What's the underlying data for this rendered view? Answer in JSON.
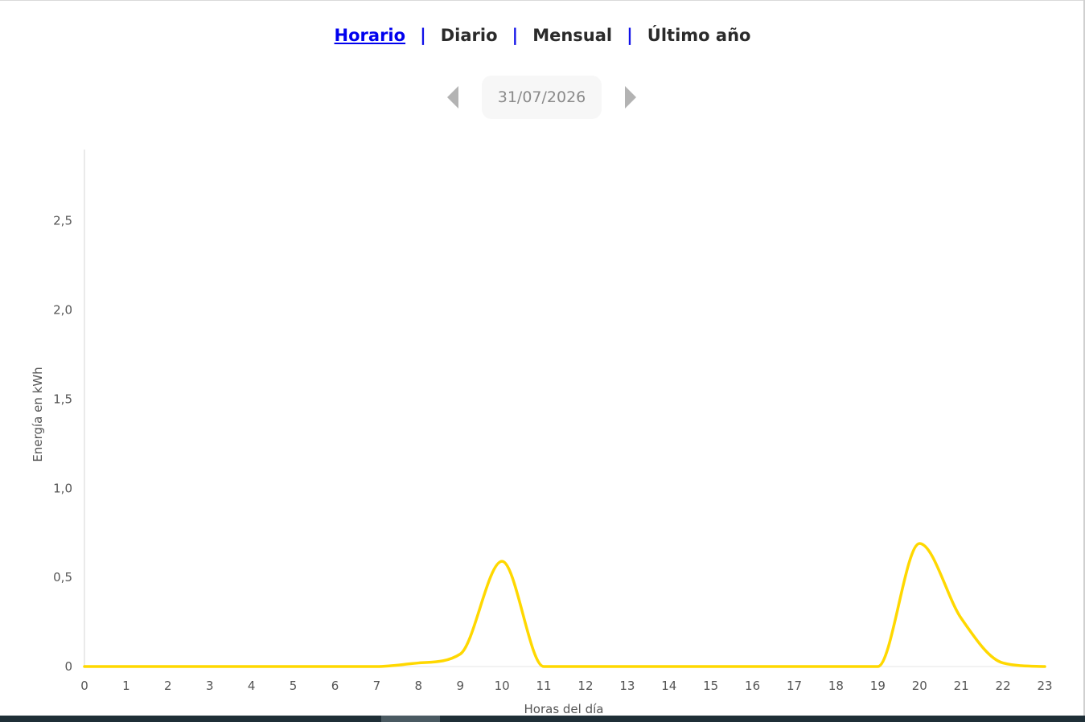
{
  "nav": {
    "tabs": [
      {
        "label": "Horario",
        "active": true
      },
      {
        "label": "Diario",
        "active": false
      },
      {
        "label": "Mensual",
        "active": false
      },
      {
        "label": "Último año",
        "active": false
      }
    ],
    "separator": "|"
  },
  "date_picker": {
    "value": "31/07/2026",
    "prev_icon": "chevron-left-icon",
    "next_icon": "chevron-right-icon"
  },
  "colors": {
    "line": "#ffd800",
    "active_tab": "#0000ee",
    "separator": "#1010e8"
  },
  "chart_data": {
    "type": "line",
    "xlabel": "Horas del día",
    "ylabel": "Energía en kWh",
    "categories": [
      "0",
      "1",
      "2",
      "3",
      "4",
      "5",
      "6",
      "7",
      "8",
      "9",
      "10",
      "11",
      "12",
      "13",
      "14",
      "15",
      "16",
      "17",
      "18",
      "19",
      "20",
      "21",
      "22",
      "23"
    ],
    "y_ticks": [
      "0",
      "0,5",
      "1,0",
      "1,5",
      "2,0",
      "2,5"
    ],
    "ylim": [
      0,
      2.9
    ],
    "grid": false,
    "series": [
      {
        "values": [
          0,
          0,
          0,
          0,
          0,
          0,
          0,
          0,
          0.02,
          0.07,
          0.59,
          0,
          0,
          0,
          0,
          0,
          0,
          0,
          0,
          0,
          0.69,
          0.27,
          0.02,
          0
        ]
      }
    ]
  }
}
